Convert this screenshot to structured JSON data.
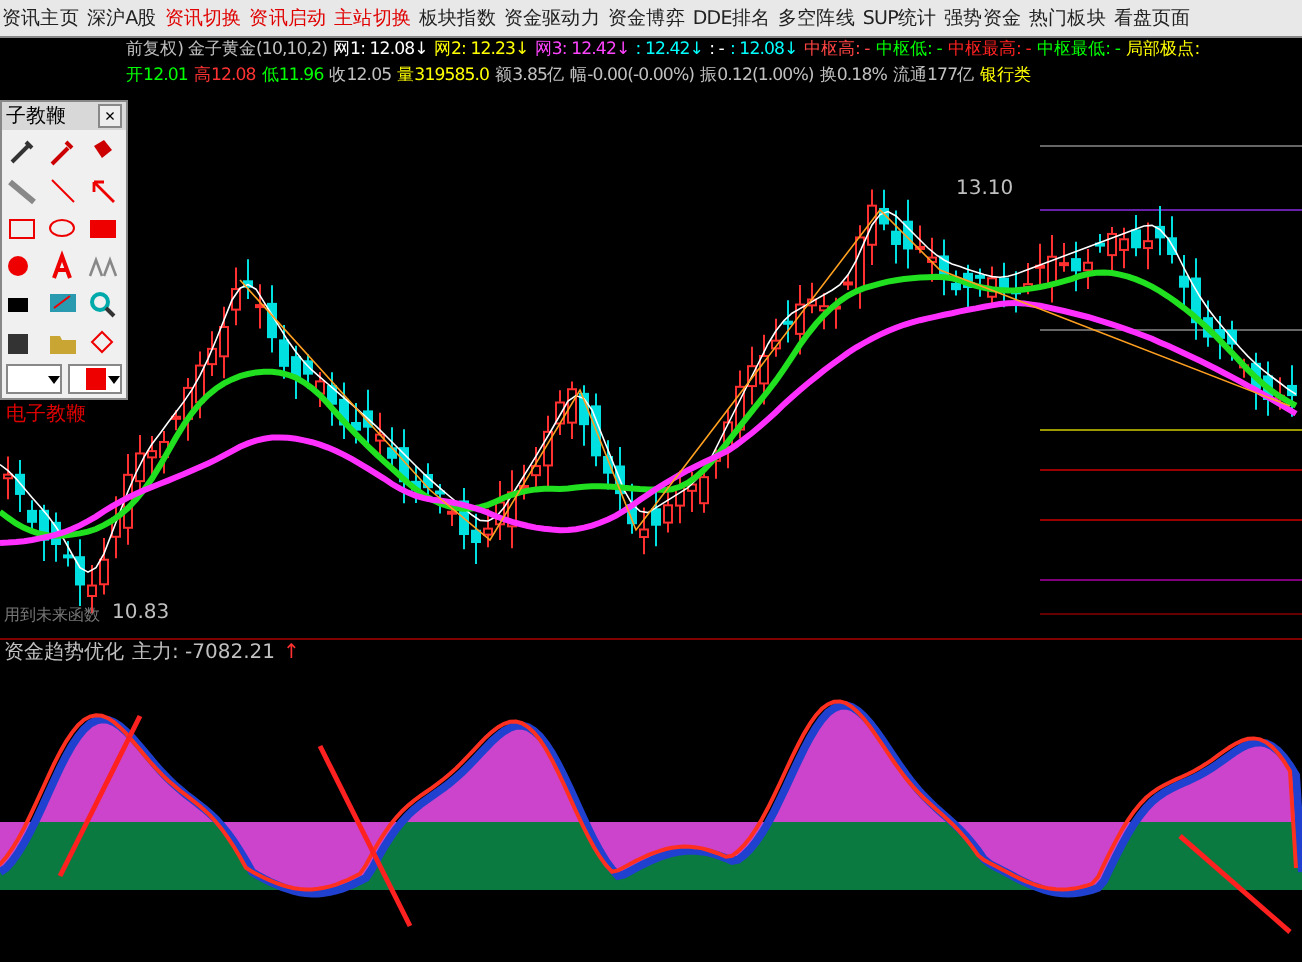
{
  "menu": [
    {
      "label": "资讯主页",
      "highlighted": false
    },
    {
      "label": "深沪A股",
      "highlighted": false
    },
    {
      "label": "资讯切换",
      "highlighted": true
    },
    {
      "label": "资讯启动",
      "highlighted": true
    },
    {
      "label": "主站切换",
      "highlighted": true
    },
    {
      "label": "板块指数",
      "highlighted": false
    },
    {
      "label": "资金驱动力",
      "highlighted": false
    },
    {
      "label": "资金博弈",
      "highlighted": false
    },
    {
      "label": "DDE排名",
      "highlighted": false
    },
    {
      "label": "多空阵线",
      "highlighted": false
    },
    {
      "label": "SUP统计",
      "highlighted": false
    },
    {
      "label": "强势资金",
      "highlighted": false
    },
    {
      "label": "热门板块",
      "highlighted": false
    },
    {
      "label": "看盘页面",
      "highlighted": false
    }
  ],
  "info_line_1": [
    {
      "text": "前复权) 金子黄金(10,10,2)",
      "color": "#c0c0c0"
    },
    {
      "text": "网1: 12.08↓",
      "color": "#ffffff"
    },
    {
      "text": "网2: 12.23↓",
      "color": "#ffff00"
    },
    {
      "text": "网3: 12.42↓",
      "color": "#ff44ff"
    },
    {
      "text": ": 12.42↓",
      "color": "#00ffff"
    },
    {
      "text": ": -",
      "color": "#ffffff"
    },
    {
      "text": ": 12.08↓",
      "color": "#00ffff"
    },
    {
      "text": "中枢高: -",
      "color": "#ff4444"
    },
    {
      "text": "中枢低: -",
      "color": "#00ff00"
    },
    {
      "text": "中枢最高: -",
      "color": "#ff2222"
    },
    {
      "text": "中枢最低: -",
      "color": "#00ff00"
    },
    {
      "text": "局部极点:",
      "color": "#ffff00"
    }
  ],
  "info_line_2": [
    {
      "text": "开12.01",
      "color": "#00ff00"
    },
    {
      "text": "高12.08",
      "color": "#ff3333"
    },
    {
      "text": "低11.96",
      "color": "#00ff00"
    },
    {
      "text": "收12.05",
      "color": "#c0c0c0"
    },
    {
      "text": "量319585.0",
      "color": "#ffff00"
    },
    {
      "text": "额3.85亿",
      "color": "#c0c0c0"
    },
    {
      "text": "幅-0.00(-0.00%)",
      "color": "#c0c0c0"
    },
    {
      "text": "振0.12(1.00%)",
      "color": "#c0c0c0"
    },
    {
      "text": "换0.18%",
      "color": "#c0c0c0"
    },
    {
      "text": "流通177亿",
      "color": "#c0c0c0"
    },
    {
      "text": "银行类",
      "color": "#ffff00"
    }
  ],
  "toolbar": {
    "title": "子教鞭",
    "close": "×",
    "label": "电子教鞭"
  },
  "chart_labels": {
    "high": "13.10",
    "low": "10.83",
    "note": "用到未来函数"
  },
  "indicator": {
    "name": "资金趋势优化",
    "reading": "主力: -7082.21",
    "arrow": "↑"
  }
}
